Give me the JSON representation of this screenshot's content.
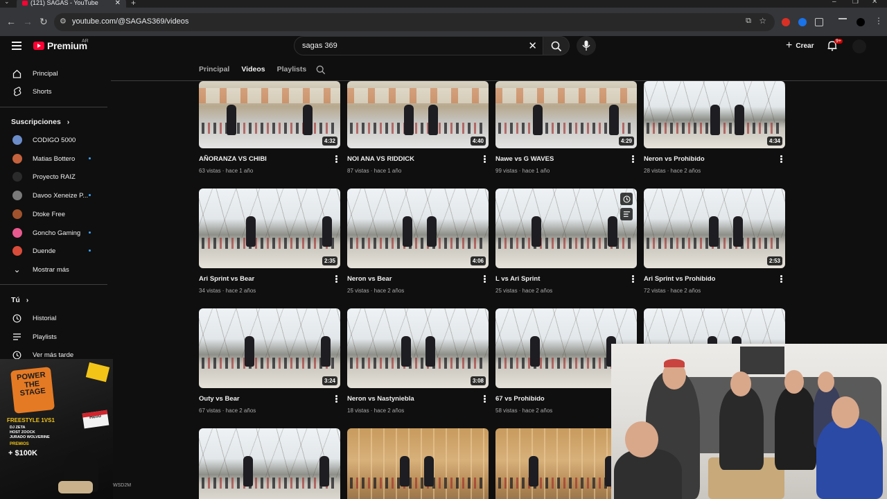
{
  "browser": {
    "tab_title": "(121) SAGAS - YouTube",
    "url": "youtube.com/@SAGAS369/videos"
  },
  "header": {
    "logo_text": "Premium",
    "country_code": "AR",
    "search_value": "sagas 369",
    "create_label": "Crear",
    "notif_badge": "9+"
  },
  "sidebar": {
    "main": [
      {
        "label": "Principal",
        "icon": "home-icon"
      },
      {
        "label": "Shorts",
        "icon": "shorts-icon"
      }
    ],
    "subs_heading": "Suscripciones",
    "subscriptions": [
      {
        "label": "CODIGO 5000",
        "color": "#6b8cc9",
        "dot": false
      },
      {
        "label": "Matias Bottero",
        "color": "#c4623d",
        "dot": true
      },
      {
        "label": "Proyecto RAIZ",
        "color": "#2b2b2b",
        "dot": false
      },
      {
        "label": "Davoo Xeneize P...",
        "color": "#7a7a7a",
        "dot": true
      },
      {
        "label": "Dtoke Free",
        "color": "#a0522d",
        "dot": false
      },
      {
        "label": "Goncho Gaming",
        "color": "#e85a8f",
        "dot": true
      },
      {
        "label": "Duende",
        "color": "#d94c3a",
        "dot": true
      }
    ],
    "show_more": "Mostrar más",
    "you_heading": "Tú",
    "you_items": [
      {
        "label": "Historial",
        "icon": "history-icon"
      },
      {
        "label": "Playlists",
        "icon": "playlists-icon"
      },
      {
        "label": "Ver más tarde",
        "icon": "watch-later-icon"
      }
    ]
  },
  "promo": {
    "title": "POWER THE STAGE",
    "event": "FREESTYLE 1VS1",
    "lineup": [
      "DJ ZETA",
      "HOST ZOOCK",
      "JURADO WOLVERINE"
    ],
    "prizes_label": "PREMIOS",
    "prize": "+ $100K",
    "sticker": "Hello",
    "footer_tag": "WSD2M"
  },
  "channel_tabs": {
    "items": [
      "Principal",
      "Videos",
      "Playlists"
    ],
    "active": "Videos"
  },
  "videos": [
    {
      "title": "AÑORANZA VS CHIBI",
      "meta": "63 vistas · hace 1 año",
      "duration": "4:32",
      "scene": "indoor"
    },
    {
      "title": "NOI ANA VS RIDDICK",
      "meta": "87 vistas · hace 1 año",
      "duration": "4:40",
      "scene": "indoor"
    },
    {
      "title": "Nawe vs G WAVES",
      "meta": "99 vistas · hace 1 año",
      "duration": "4:29",
      "scene": "indoor"
    },
    {
      "title": "Neron vs Prohibido",
      "meta": "28 vistas · hace 2 años",
      "duration": "4:34",
      "scene": "outdoor"
    },
    {
      "title": "Ari Sprint vs Bear",
      "meta": "34 vistas · hace 2 años",
      "duration": "2:35",
      "scene": "outdoor"
    },
    {
      "title": "Neron vs Bear",
      "meta": "25 vistas · hace 2 años",
      "duration": "4:06",
      "scene": "outdoor"
    },
    {
      "title": "L vs Ari Sprint",
      "meta": "25 vistas · hace 2 años",
      "duration": "",
      "scene": "outdoor"
    },
    {
      "title": "Ari Sprint vs Prohibido",
      "meta": "72 vistas · hace 2 años",
      "duration": "2:53",
      "scene": "outdoor"
    },
    {
      "title": "Outy vs Bear",
      "meta": "67 vistas · hace 2 años",
      "duration": "3:24",
      "scene": "outdoor"
    },
    {
      "title": "Neron vs Nastyniebla",
      "meta": "18 vistas · hace 2 años",
      "duration": "3:08",
      "scene": "outdoor"
    },
    {
      "title": "67 vs Prohibido",
      "meta": "58 vistas · hace 2 años",
      "duration": "",
      "scene": "outdoor"
    },
    {
      "title": "",
      "meta": "",
      "duration": "",
      "scene": "outdoor"
    },
    {
      "title": "",
      "meta": "",
      "duration": "",
      "scene": "outdoor"
    },
    {
      "title": "",
      "meta": "",
      "duration": "",
      "scene": "warm"
    },
    {
      "title": "",
      "meta": "",
      "duration": "",
      "scene": "warm"
    }
  ]
}
